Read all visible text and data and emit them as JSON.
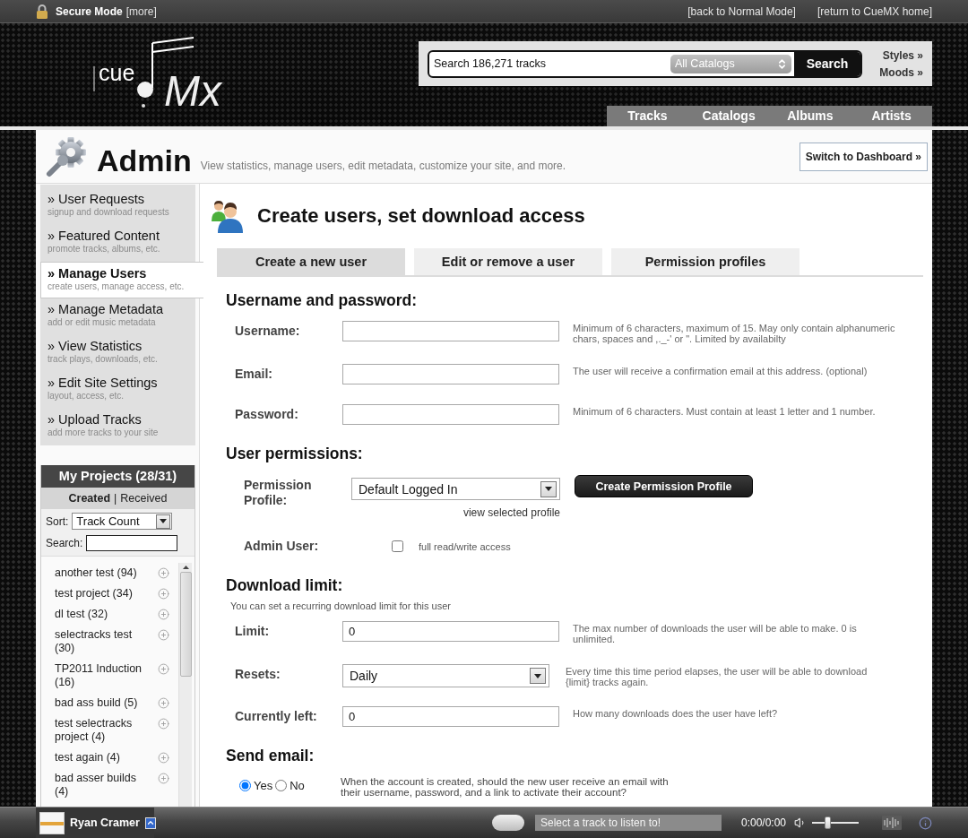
{
  "top_bar": {
    "mode": "Secure Mode",
    "more": "[more]",
    "links": [
      "[back to Normal Mode]",
      "[return to CueMX home]"
    ]
  },
  "logo": {
    "small": "cue",
    "large": "Mx"
  },
  "search": {
    "placeholder": "Search 186,271 tracks",
    "catalog": "All Catalogs",
    "button": "Search",
    "links": [
      "Styles »",
      "Moods »"
    ]
  },
  "nav": [
    "Tracks",
    "Catalogs",
    "Albums",
    "Artists"
  ],
  "page_header": {
    "title": "Admin",
    "subtitle": "View statistics, manage users, edit metadata, customize your site, and more.",
    "button": "Switch to Dashboard »"
  },
  "sidebar": {
    "items": [
      {
        "title": "» User Requests",
        "subtitle": "signup and download requests",
        "selected": false
      },
      {
        "title": "» Featured Content",
        "subtitle": "promote tracks, albums, etc.",
        "selected": false
      },
      {
        "title": "» Manage Users",
        "subtitle": "create users, manage access, etc.",
        "selected": true
      },
      {
        "title": "» Manage Metadata",
        "subtitle": "add or edit music metadata",
        "selected": false
      },
      {
        "title": "» View Statistics",
        "subtitle": "track plays, downloads, etc.",
        "selected": false
      },
      {
        "title": "» Edit Site Settings",
        "subtitle": "layout, access, etc.",
        "selected": false
      },
      {
        "title": "» Upload Tracks",
        "subtitle": "add more tracks to your site",
        "selected": false
      }
    ]
  },
  "projects": {
    "title": "My Projects (28/31)",
    "filters": [
      {
        "label": "Created",
        "selected": true
      },
      {
        "label": "Received",
        "selected": false
      }
    ],
    "separator": "|",
    "sort_label": "Sort:",
    "sort_value": "Track Count",
    "search_label": "Search:",
    "items": [
      "another test (94)",
      "test project (34)",
      "dl test (32)",
      "selectracks test (30)",
      "TP2011 Induction (16)",
      "bad ass build (5)",
      "test selectracks project (4)",
      "test again (4)",
      "bad asser builds (4)"
    ]
  },
  "content": {
    "title": "Create users, set download access",
    "tabs": [
      {
        "label": "Create a new user",
        "selected": true
      },
      {
        "label": "Edit or remove a user",
        "selected": false
      },
      {
        "label": "Permission profiles",
        "selected": false
      }
    ],
    "sections": [
      {
        "heading": "Username and password:",
        "rows": [
          {
            "kind": "input",
            "label": "Username:",
            "hint": "Minimum of 6 characters, maximum of 15. May only contain alphanumeric chars, spaces and ,._-' or \". Limited by availabilty"
          },
          {
            "kind": "input",
            "label": "Email:",
            "hint": "The user will receive a confirmation email at this address. (optional)"
          },
          {
            "kind": "input",
            "label": "Password:",
            "hint": "Minimum of 6 characters. Must contain at least 1 letter and 1 number."
          }
        ]
      },
      {
        "heading": "User permissions:",
        "rows": [
          {
            "kind": "profile",
            "label": "Permission Profile:",
            "value": "Default Logged In",
            "link": "view selected profile",
            "button": "Create Permission Profile"
          },
          {
            "kind": "checkbox",
            "label": "Admin User:",
            "checked": false,
            "hint": "full read/write access"
          }
        ]
      },
      {
        "heading": "Download limit:",
        "note": "You can set a recurring download limit for this user",
        "rows": [
          {
            "kind": "input",
            "label": "Limit:",
            "value": "0",
            "hint": "The max number of downloads the user will be able to make. 0 is unlimited."
          },
          {
            "kind": "select",
            "label": "Resets:",
            "value": "Daily",
            "hint": "Every time this time period elapses, the user will be able to download {limit} tracks again."
          },
          {
            "kind": "input",
            "label": "Currently left:",
            "value": "0",
            "hint": "How many downloads does the user have left?"
          }
        ]
      },
      {
        "heading": "Send email:",
        "rows": [
          {
            "kind": "radio",
            "options": [
              {
                "label": "Yes",
                "selected": true
              },
              {
                "label": "No",
                "selected": false
              }
            ],
            "hint": "When the account is created, should the new user receive an email with their username, password, and a link to activate their account?"
          }
        ]
      }
    ]
  },
  "player": {
    "user": "Ryan Cramer",
    "track": "Select a track to listen to!",
    "time": "0:00/0:00",
    "volume": {
      "level": 0.3
    }
  }
}
